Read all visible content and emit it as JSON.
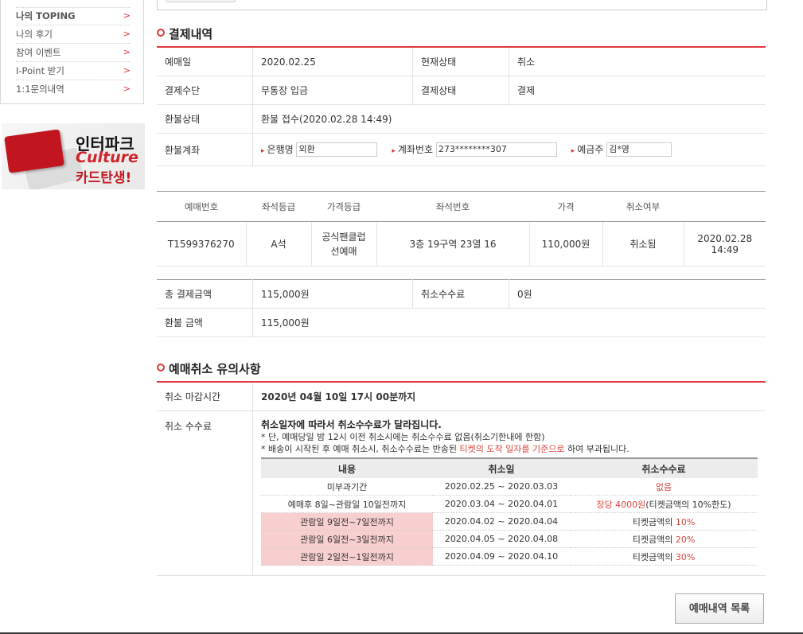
{
  "sidebar": {
    "items": [
      {
        "label": "나의 TOPING",
        "arrow": ">"
      },
      {
        "label": "나의 후기",
        "arrow": ">"
      },
      {
        "label": "참여 이벤트",
        "arrow": ">"
      },
      {
        "label": "I-Point 받기",
        "arrow": ">"
      },
      {
        "label": "1:1문의내역",
        "arrow": ">"
      }
    ],
    "banner": {
      "line1": "인터파크",
      "line2": "Culture",
      "line3": "카드탄생!"
    }
  },
  "payment": {
    "title": "결제내역",
    "reserve_date_label": "예매일",
    "reserve_date": "2020.02.25",
    "current_status_label": "현재상태",
    "current_status": "취소",
    "method_label": "결제수단",
    "method": "무통장 입금",
    "payment_status_label": "결제상태",
    "payment_status": "결제",
    "refund_status_label": "환불상태",
    "refund_status": "환불 접수(2020.02.28 14:49)",
    "refund_account_label": "환불계좌",
    "bank_label": "은행명",
    "bank_value": "외환",
    "account_label": "계좌번호",
    "account_value": "273********307",
    "holder_label": "예금주",
    "holder_value": "김*영"
  },
  "ticket": {
    "headers": [
      "예매번호",
      "좌석등급",
      "가격등급",
      "좌석번호",
      "가격",
      "취소여부",
      ""
    ],
    "row": {
      "reserve_no": "T1599376270",
      "seat_grade": "A석",
      "price_grade": "공식팬클럽 선예매",
      "seat_no": "3층 19구역 23열 16",
      "price": "110,000원",
      "cancel_status": "취소됨",
      "cancel_time": "2020.02.28 14:49"
    }
  },
  "totals": {
    "total_label": "총 결제금액",
    "total_value": "115,000원",
    "fee_label": "취소수수료",
    "fee_value": "0원",
    "refund_label": "환불 금액",
    "refund_value": "115,000원"
  },
  "notice": {
    "title": "예매취소 유의사항",
    "deadline_label": "취소 마감시간",
    "deadline_value": "2020년 04월 10일 17시 00분까지",
    "fee_label": "취소 수수료",
    "fee_heading": "취소일자에 따라서 취소수수료가 달라집니다.",
    "fee_note1": "* 단, 예매당일 밤 12시 이전 취소시에는 취소수수료 없음(취소기한내에 한함)",
    "fee_note2_pre": "* 배송이 시작된 후 예매 취소시, 취소수수료는 반송된",
    "fee_note2_red": "티켓의 도착 일자를 기준으로",
    "fee_note2_post": "하여 부과됩니다.",
    "table_headers": [
      "내용",
      "취소일",
      "취소수수료"
    ],
    "rows": [
      {
        "content": "미부과기간",
        "date": "2020.02.25 ~ 2020.03.03",
        "fee_red": "없음",
        "fee_post": "",
        "fee_pre": "",
        "pink": false
      },
      {
        "content": "예매후 8일~관람일 10일전까지",
        "date": "2020.03.04 ~ 2020.04.01",
        "fee_red": "장당 4000원",
        "fee_post": "(티켓금액의 10%한도)",
        "fee_pre": "",
        "pink": false
      },
      {
        "content": "관람일 9일전~7일전까지",
        "date": "2020.04.02 ~ 2020.04.04",
        "fee_pre": "티켓금액의 ",
        "fee_red": "10%",
        "fee_post": "",
        "pink": true
      },
      {
        "content": "관람일 6일전~3일전까지",
        "date": "2020.04.05 ~ 2020.04.08",
        "fee_pre": "티켓금액의 ",
        "fee_red": "20%",
        "fee_post": "",
        "pink": true
      },
      {
        "content": "관람일 2일전~1일전까지",
        "date": "2020.04.09 ~ 2020.04.10",
        "fee_pre": "티켓금액의 ",
        "fee_red": "30%",
        "fee_post": "",
        "pink": true
      }
    ]
  },
  "list_button": "예매내역 목록"
}
